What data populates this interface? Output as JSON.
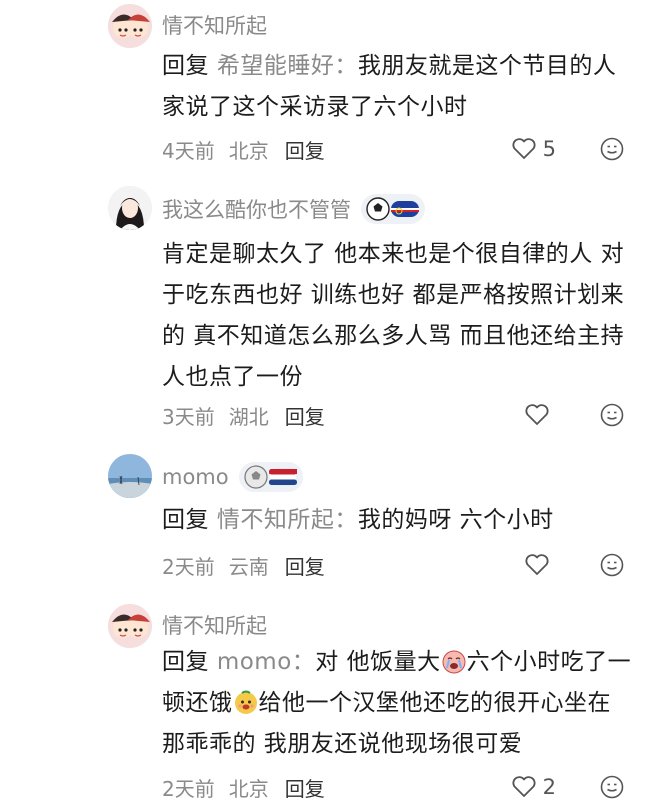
{
  "comments": [
    {
      "username": "情不知所起",
      "reply_tag": "回复",
      "reply_target": "希望能睡好：",
      "text": "我朋友就是这个节目的人家说了这个采访录了六个小时",
      "time": "4天前",
      "location": "北京",
      "reply_label": "回复",
      "likes": "5"
    },
    {
      "username": "我这么酷你也不管管",
      "text": "肯定是聊太久了 他本来也是个很自律的人 对于吃东西也好 训练也好 都是严格按照计划来的 真不知道怎么那么多人骂 而且他还给主持人也点了一份",
      "time": "3天前",
      "location": "湖北",
      "reply_label": "回复",
      "likes": ""
    },
    {
      "username": "momo",
      "reply_tag": "回复",
      "reply_target": "情不知所起：",
      "text": "我的妈呀 六个小时",
      "time": "2天前",
      "location": "云南",
      "reply_label": "回复",
      "likes": ""
    },
    {
      "username": "情不知所起",
      "reply_tag": "回复",
      "reply_target": "momo：",
      "text_a": "对 他饭量大",
      "text_b": "六个小时吃了一顿还饿",
      "text_c": "给他一个汉堡他还吃的很开心坐在那乖乖的 我朋友还说他现场很可爱",
      "time": "2天前",
      "location": "北京",
      "reply_label": "回复",
      "likes": "2"
    }
  ]
}
